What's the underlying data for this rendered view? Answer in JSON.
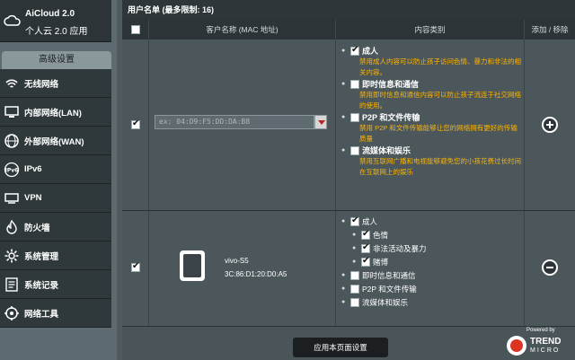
{
  "aicloud": {
    "title": "AiCloud 2.0",
    "subtitle": "个人云 2.0 应用"
  },
  "sidebar": {
    "header": "高级设置",
    "items": [
      {
        "label": "无线网络",
        "icon": "wifi-icon"
      },
      {
        "label": "内部网络(LAN)",
        "icon": "lan-icon"
      },
      {
        "label": "外部网络(WAN)",
        "icon": "globe-icon"
      },
      {
        "label": "IPv6",
        "icon": "ipv6-icon"
      },
      {
        "label": "VPN",
        "icon": "vpn-icon"
      },
      {
        "label": "防火墙",
        "icon": "firewall-icon"
      },
      {
        "label": "系统管理",
        "icon": "gear-icon"
      },
      {
        "label": "系统记录",
        "icon": "log-icon"
      },
      {
        "label": "网络工具",
        "icon": "tools-icon"
      }
    ]
  },
  "panel": {
    "title": "用户名单 (最多限制: 16)",
    "columns": {
      "client": "客户名称 (MAC 地址)",
      "category": "内容类别",
      "action": "添加 / 移除"
    }
  },
  "new_row": {
    "mac_placeholder": "ex: 04:D9:F5:DD:DA:B8",
    "categories": [
      {
        "label": "成人",
        "desc": "禁用成人内容可以防止孩子访问色情、暴力和非法的相关内容。"
      },
      {
        "label": "即时信息和通信",
        "desc": "禁用即时信息和通信内容可以防止孩子流连于社交网络的使用。"
      },
      {
        "label": "P2P 和文件传输",
        "desc": "禁用 P2P 和文件传输能够让您的网络拥有更好的传输质量"
      },
      {
        "label": "流媒体和娱乐",
        "desc": "禁用互联网广播和电视能够避免您的小孩花费过长时间在互联网上的娱乐"
      }
    ]
  },
  "device_row": {
    "name": "vivo-S5",
    "mac": "3C:86:D1:20:D0:A5",
    "categories": [
      {
        "label": "成人",
        "sub": [
          "色情",
          "非法活动及暴力",
          "赌博"
        ]
      },
      {
        "label": "即时信息和通信"
      },
      {
        "label": "P2P 和文件传输"
      },
      {
        "label": "流媒体和娱乐"
      }
    ]
  },
  "footer": {
    "apply": "应用本页面设置",
    "powered_by": "Powered by",
    "brand_top": "TREND",
    "brand_bottom": "MICRO"
  }
}
